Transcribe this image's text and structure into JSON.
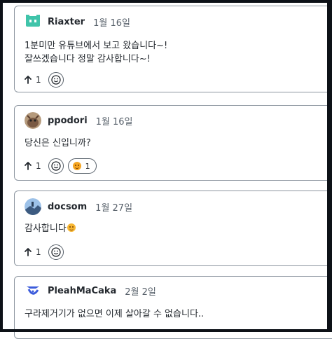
{
  "comments": [
    {
      "author": "Riaxter",
      "date": "1월 16일",
      "avatar_icon": "robot-icon",
      "avatar_color": "#40c4aa",
      "lines": [
        "1분미만 유튜브에서 보고 왔습니다~!",
        "잘쓰겠습니다 정말 감사합니다~!"
      ],
      "upvotes": "1"
    },
    {
      "author": "ppodori",
      "date": "1월 16일",
      "avatar_icon": "cat-photo-icon",
      "lines": [
        "당신은 신입니까?"
      ],
      "upvotes": "1",
      "reaction_count": "1",
      "reaction_icon": "heart-eyes-emoji-icon"
    },
    {
      "author": "docsom",
      "date": "1월 27일",
      "avatar_icon": "landscape-photo-icon",
      "lines": [
        "감사합니다"
      ],
      "inline_emoji": "smiling-emoji-icon",
      "upvotes": "1"
    },
    {
      "author": "PleahMaCaka",
      "date": "2월 2일",
      "avatar_icon": "blue-logo-icon",
      "avatar_color": "#3b5bdb",
      "lines": [
        "구라제거기가 없으면 이제 살아갈 수 없습니다.."
      ]
    }
  ],
  "colors": {
    "border": "#8c959f",
    "text": "#24292f",
    "muted": "#57606a",
    "frame": "#0d1117"
  }
}
